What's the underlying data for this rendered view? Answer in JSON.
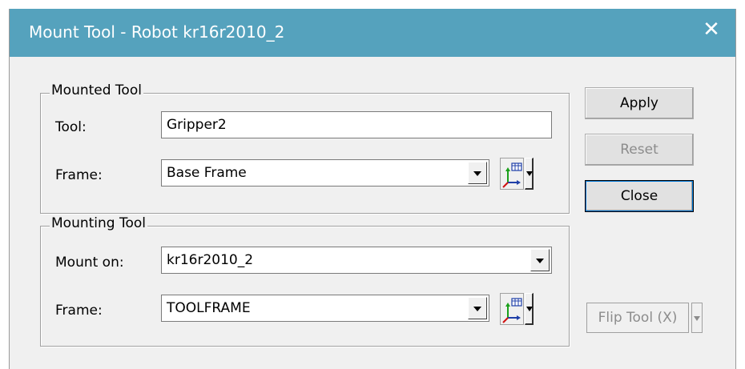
{
  "window": {
    "title": "Mount Tool - Robot kr16r2010_2",
    "close_glyph": "✕"
  },
  "mounted_tool": {
    "legend": "Mounted Tool",
    "tool_label": "Tool:",
    "tool_value": "Gripper2",
    "frame_label": "Frame:",
    "frame_value": "Base Frame"
  },
  "mounting_tool": {
    "legend": "Mounting Tool",
    "mount_on_label": "Mount on:",
    "mount_on_value": "kr16r2010_2",
    "frame_label": "Frame:",
    "frame_value": "TOOLFRAME"
  },
  "buttons": {
    "apply": "Apply",
    "reset": "Reset",
    "close": "Close",
    "flip_tool": "Flip Tool (X)"
  },
  "icons": {
    "frame_picker": "coordinate-frame-icon",
    "dropdown": "chevron-down-icon",
    "close": "close-icon"
  },
  "colors": {
    "titlebar": "#55a2bd",
    "dialog_bg": "#f0f0f0"
  }
}
